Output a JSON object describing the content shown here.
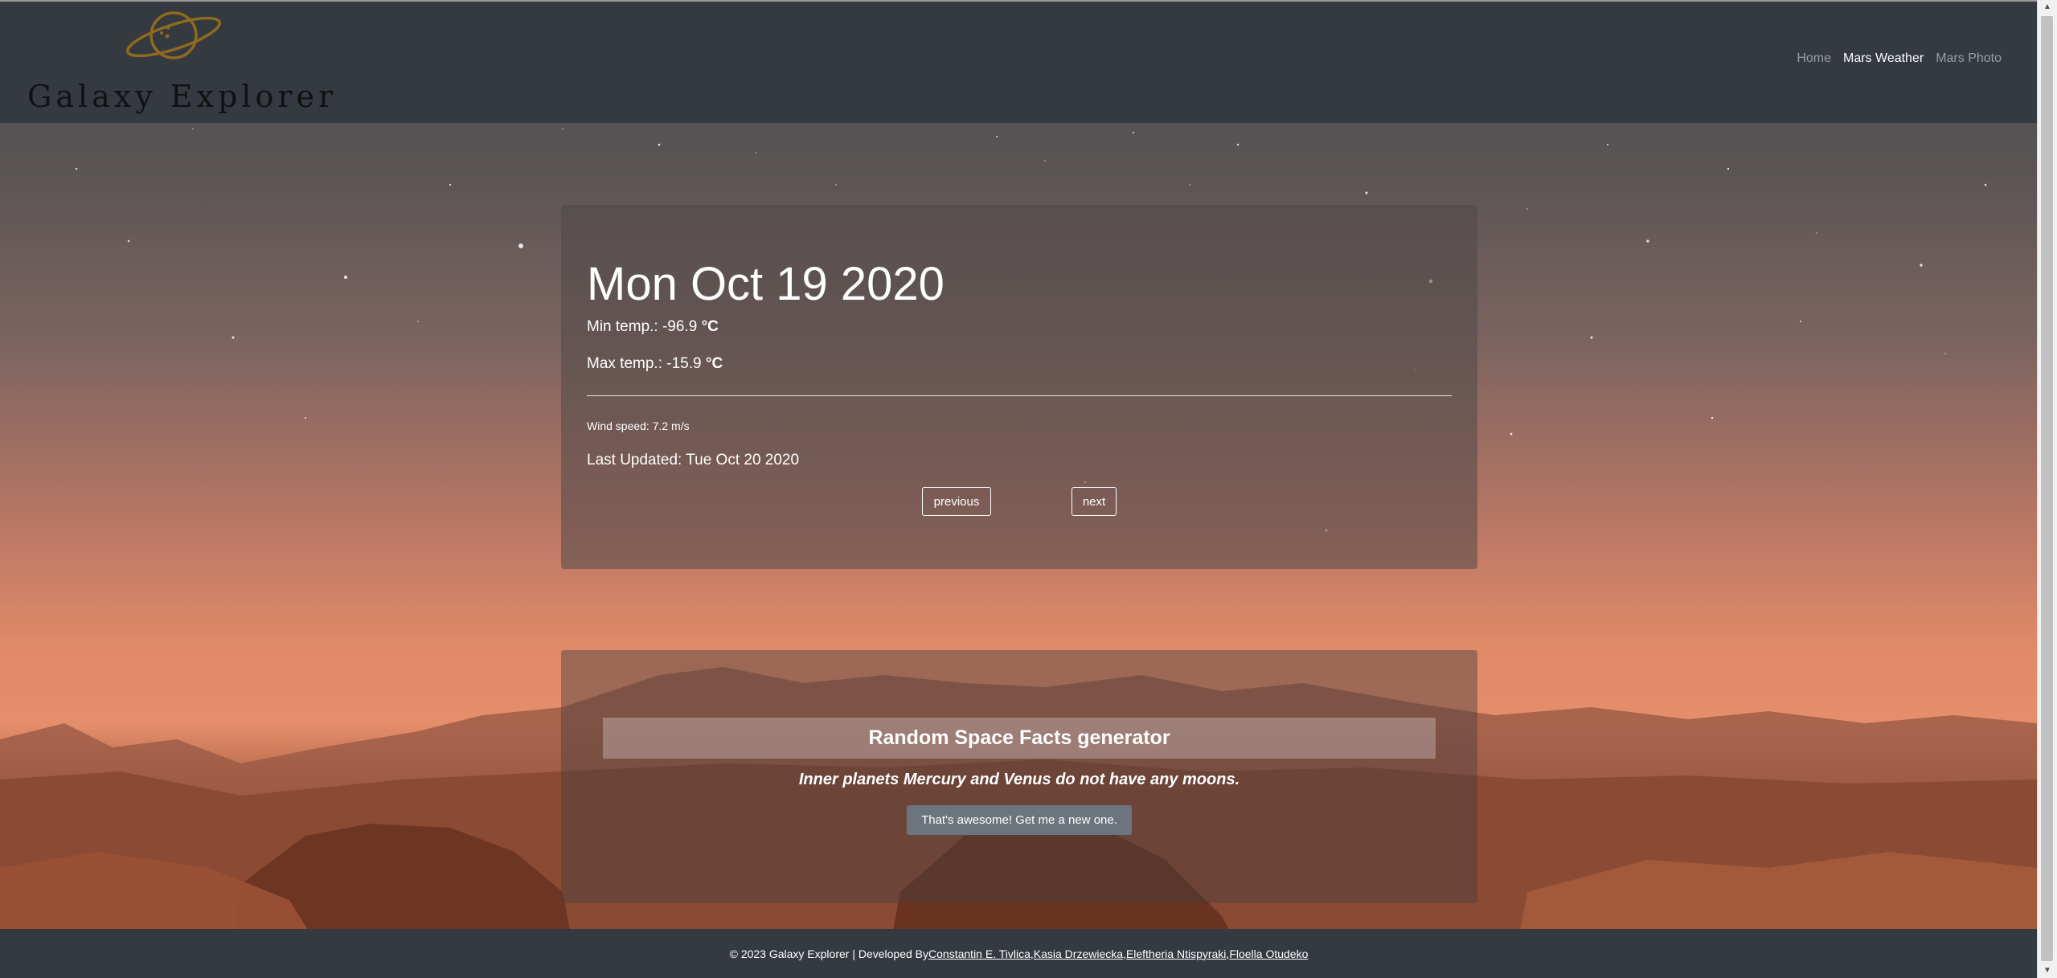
{
  "colors": {
    "navbar_bg": "#343a40",
    "nav_link_inactive": "#9a9fa4",
    "nav_link_active": "#ffffff",
    "brand_logo_gold": "#8f6a1f",
    "button_secondary": "#6c757d"
  },
  "brand": {
    "name": "Galaxy Explorer",
    "logo_icon": "ringed-planet-icon"
  },
  "nav": {
    "items": [
      {
        "label": "Home",
        "active": false
      },
      {
        "label": "Mars Weather",
        "active": true
      },
      {
        "label": "Mars Photo",
        "active": false
      }
    ]
  },
  "weather": {
    "date": "Mon Oct 19 2020",
    "min_label": "Min temp.: ",
    "min_value": "-96.9",
    "max_label": "Max temp.: ",
    "max_value": "-15.9",
    "unit": "°C",
    "wind": "Wind speed: 7.2 m/s",
    "updated": "Last Updated: Tue Oct 20 2020",
    "previous_label": "previous",
    "next_label": "next"
  },
  "facts": {
    "title": "Random Space Facts generator",
    "fact": "Inner planets Mercury and Venus do not have any moons.",
    "button_label": "That's awesome! Get me a new one."
  },
  "footer": {
    "prefix": "© 2023 Galaxy Explorer | Developed By ",
    "developers": [
      "Constantin E. Tivlica",
      "Kasia Drzewiecka",
      "Eleftheria Ntispyraki",
      "Floella Otudeko"
    ],
    "separator": ", "
  }
}
